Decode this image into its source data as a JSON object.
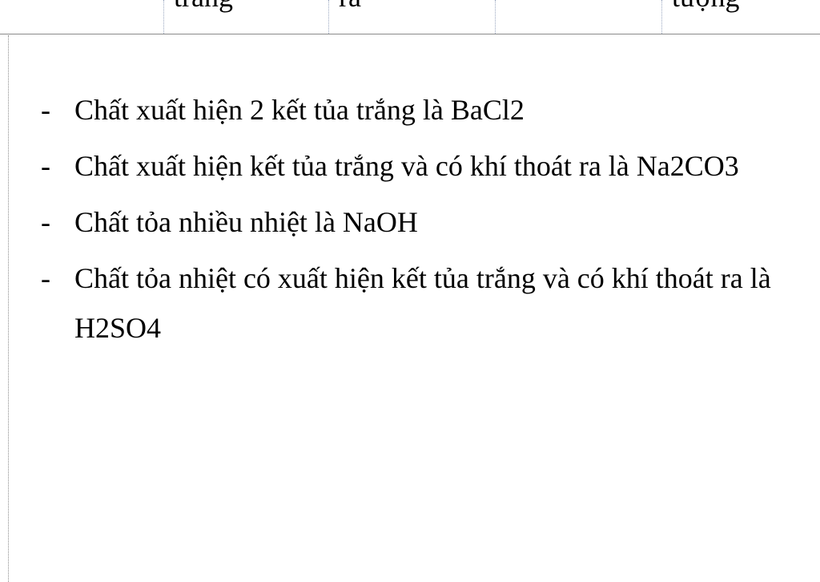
{
  "table_header_fragments": [
    {
      "text": ""
    },
    {
      "text": "trắng"
    },
    {
      "text": "ra"
    },
    {
      "text": ""
    },
    {
      "text": "tượng"
    }
  ],
  "observations": {
    "bullet": "-",
    "items": [
      {
        "text": "Chất xuất hiện 2 kết tủa trắng là BaCl2"
      },
      {
        "text": "Chất xuất hiện kết tủa trắng và có khí thoát ra là Na2CO3"
      },
      {
        "text": "Chất tỏa nhiều nhiệt là NaOH"
      },
      {
        "text": "Chất tỏa nhiệt có xuất hiện kết tủa trắng và có khí thoát ra là H2SO4"
      }
    ]
  }
}
